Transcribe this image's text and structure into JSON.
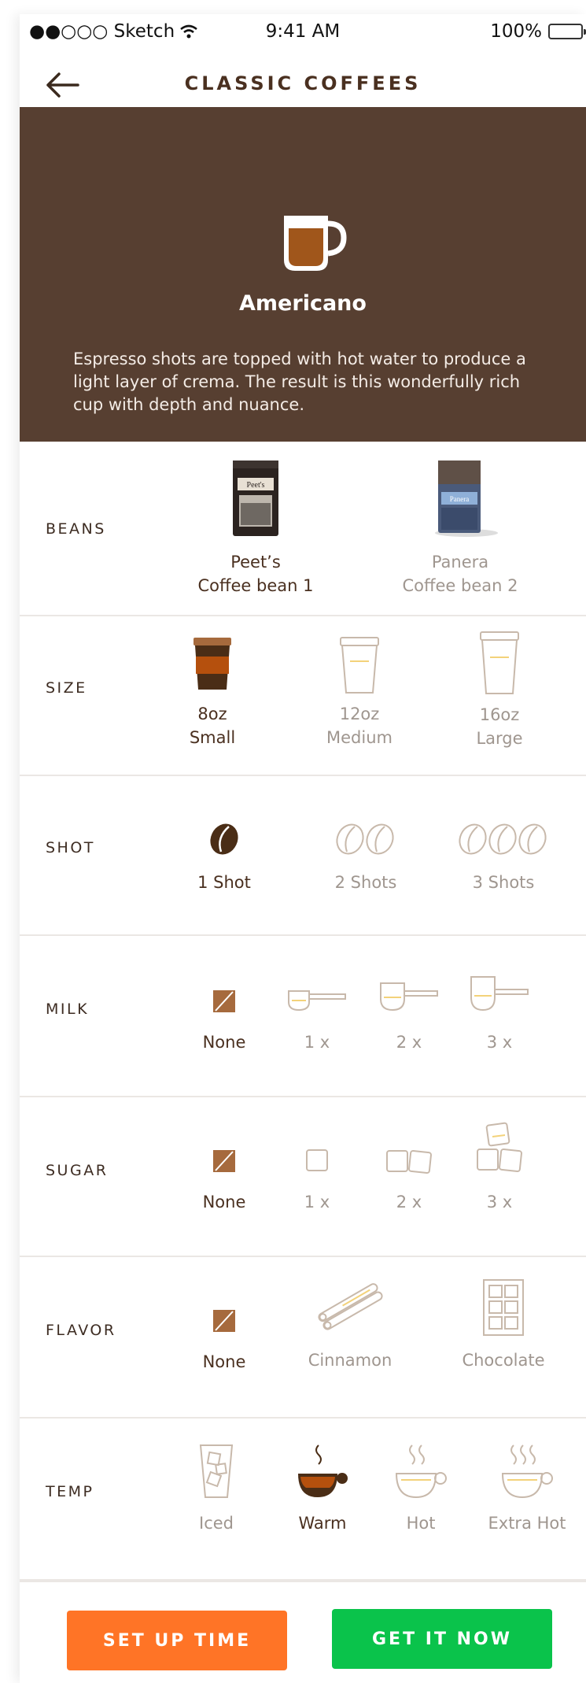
{
  "status_bar": {
    "carrier": "●●○○○ Sketch",
    "time": "9:41 AM",
    "battery": "100%"
  },
  "nav": {
    "title": "CLASSIC COFFEES"
  },
  "hero": {
    "name": "Americano",
    "description": "Espresso shots are topped with hot water to produce a light layer of crema. The result is this wonderfully rich cup with depth and nuance."
  },
  "beans": {
    "label": "BEANS",
    "options": [
      {
        "line1": "Peet’s",
        "line2": "Coffee bean 1"
      },
      {
        "line1": "Panera",
        "line2": "Coffee bean 2"
      }
    ]
  },
  "size": {
    "label": "SIZE",
    "options": [
      {
        "line1": "8oz",
        "line2": "Small"
      },
      {
        "line1": "12oz",
        "line2": "Medium"
      },
      {
        "line1": "16oz",
        "line2": "Large"
      }
    ]
  },
  "shot": {
    "label": "SHOT",
    "options": [
      "1 Shot",
      "2 Shots",
      "3 Shots"
    ]
  },
  "milk": {
    "label": "MILK",
    "options": [
      "None",
      "1 x",
      "2 x",
      "3 x"
    ]
  },
  "sugar": {
    "label": "SUGAR",
    "options": [
      "None",
      "1 x",
      "2 x",
      "3 x"
    ]
  },
  "flavor": {
    "label": "FLAVOR",
    "options": [
      "None",
      "Cinnamon",
      "Chocolate"
    ]
  },
  "temp": {
    "label": "TEMP",
    "options": [
      "Iced",
      "Warm",
      "Hot",
      "Extra Hot"
    ]
  },
  "buttons": {
    "setup": "SET UP TIME",
    "get": "GET IT NOW"
  },
  "colors": {
    "accent_brown": "#573f31",
    "selected_brown": "#a66a3d",
    "outline": "#c8b9ab",
    "orange": "#ff7426",
    "green": "#0ac34b"
  }
}
